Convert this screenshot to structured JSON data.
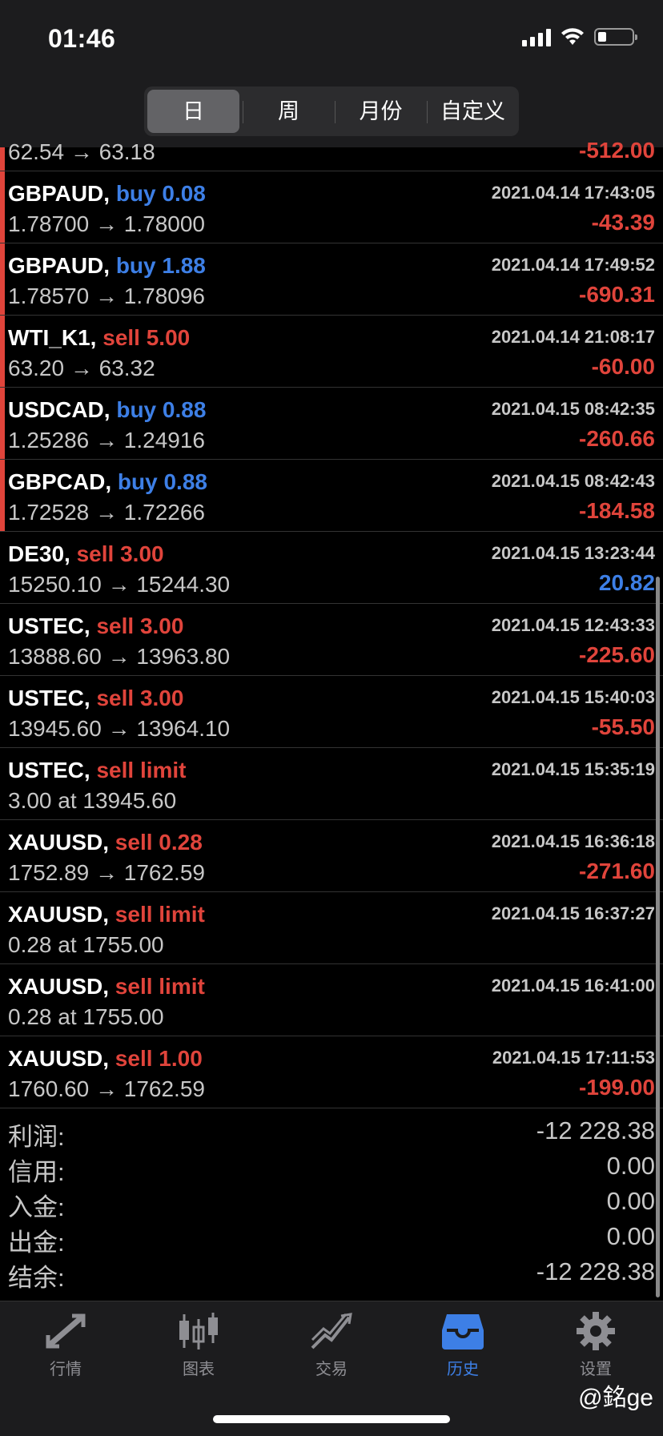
{
  "status_bar": {
    "time": "01:46"
  },
  "segments": [
    {
      "label": "日",
      "active": true
    },
    {
      "label": "周",
      "active": false
    },
    {
      "label": "月份",
      "active": false
    },
    {
      "label": "自定义",
      "active": false
    }
  ],
  "partial_row": {
    "price": "62.54 → 63.18",
    "profit": "-512.00"
  },
  "rows": [
    {
      "symbol": "GBPAUD,",
      "side": "buy 0.08",
      "side_type": "buy",
      "date": "2021.04.14 17:43:05",
      "price": "1.78700 → 1.78000",
      "profit": "-43.39",
      "profit_type": "neg",
      "mark": true
    },
    {
      "symbol": "GBPAUD,",
      "side": "buy 1.88",
      "side_type": "buy",
      "date": "2021.04.14 17:49:52",
      "price": "1.78570 → 1.78096",
      "profit": "-690.31",
      "profit_type": "neg",
      "mark": true
    },
    {
      "symbol": "WTI_K1,",
      "side": "sell 5.00",
      "side_type": "sell",
      "date": "2021.04.14 21:08:17",
      "price": "63.20 → 63.32",
      "profit": "-60.00",
      "profit_type": "neg",
      "mark": true
    },
    {
      "symbol": "USDCAD,",
      "side": "buy 0.88",
      "side_type": "buy",
      "date": "2021.04.15 08:42:35",
      "price": "1.25286 → 1.24916",
      "profit": "-260.66",
      "profit_type": "neg",
      "mark": true
    },
    {
      "symbol": "GBPCAD,",
      "side": "buy 0.88",
      "side_type": "buy",
      "date": "2021.04.15 08:42:43",
      "price": "1.72528 → 1.72266",
      "profit": "-184.58",
      "profit_type": "neg",
      "mark": true
    },
    {
      "symbol": "DE30,",
      "side": "sell 3.00",
      "side_type": "sell",
      "date": "2021.04.15 13:23:44",
      "price": "15250.10 → 15244.30",
      "profit": "20.82",
      "profit_type": "pos",
      "mark": false
    },
    {
      "symbol": "USTEC,",
      "side": "sell 3.00",
      "side_type": "sell",
      "date": "2021.04.15 12:43:33",
      "price": "13888.60 → 13963.80",
      "profit": "-225.60",
      "profit_type": "neg",
      "mark": false
    },
    {
      "symbol": "USTEC,",
      "side": "sell 3.00",
      "side_type": "sell",
      "date": "2021.04.15 15:40:03",
      "price": "13945.60 → 13964.10",
      "profit": "-55.50",
      "profit_type": "neg",
      "mark": false
    },
    {
      "symbol": "USTEC,",
      "side": "sell limit",
      "side_type": "sell",
      "date": "2021.04.15 15:35:19",
      "price": "3.00 at 13945.60",
      "profit": "",
      "profit_type": "neg",
      "mark": false
    },
    {
      "symbol": "XAUUSD,",
      "side": "sell 0.28",
      "side_type": "sell",
      "date": "2021.04.15 16:36:18",
      "price": "1752.89 → 1762.59",
      "profit": "-271.60",
      "profit_type": "neg",
      "mark": false
    },
    {
      "symbol": "XAUUSD,",
      "side": "sell limit",
      "side_type": "sell",
      "date": "2021.04.15 16:37:27",
      "price": "0.28 at 1755.00",
      "profit": "",
      "profit_type": "neg",
      "mark": false
    },
    {
      "symbol": "XAUUSD,",
      "side": "sell limit",
      "side_type": "sell",
      "date": "2021.04.15 16:41:00",
      "price": "0.28 at 1755.00",
      "profit": "",
      "profit_type": "neg",
      "mark": false
    },
    {
      "symbol": "XAUUSD,",
      "side": "sell 1.00",
      "side_type": "sell",
      "date": "2021.04.15 17:11:53",
      "price": "1760.60 → 1762.59",
      "profit": "-199.00",
      "profit_type": "neg",
      "mark": false
    }
  ],
  "summary": [
    {
      "label": "利润:",
      "value": "-12 228.38"
    },
    {
      "label": "信用:",
      "value": "0.00"
    },
    {
      "label": "入金:",
      "value": "0.00"
    },
    {
      "label": "出金:",
      "value": "0.00"
    },
    {
      "label": "结余:",
      "value": "-12 228.38"
    }
  ],
  "tabs": [
    {
      "label": "行情",
      "icon": "quotes-arrows-icon",
      "active": false
    },
    {
      "label": "图表",
      "icon": "candlestick-icon",
      "active": false
    },
    {
      "label": "交易",
      "icon": "trade-chart-icon",
      "active": false
    },
    {
      "label": "历史",
      "icon": "history-inbox-icon",
      "active": true
    },
    {
      "label": "设置",
      "icon": "gear-icon",
      "active": false
    }
  ],
  "watermark": "@銘ge",
  "colors": {
    "buy": "#3d7fe6",
    "sell": "#e0443b",
    "active_tab": "#3d7fe6"
  }
}
